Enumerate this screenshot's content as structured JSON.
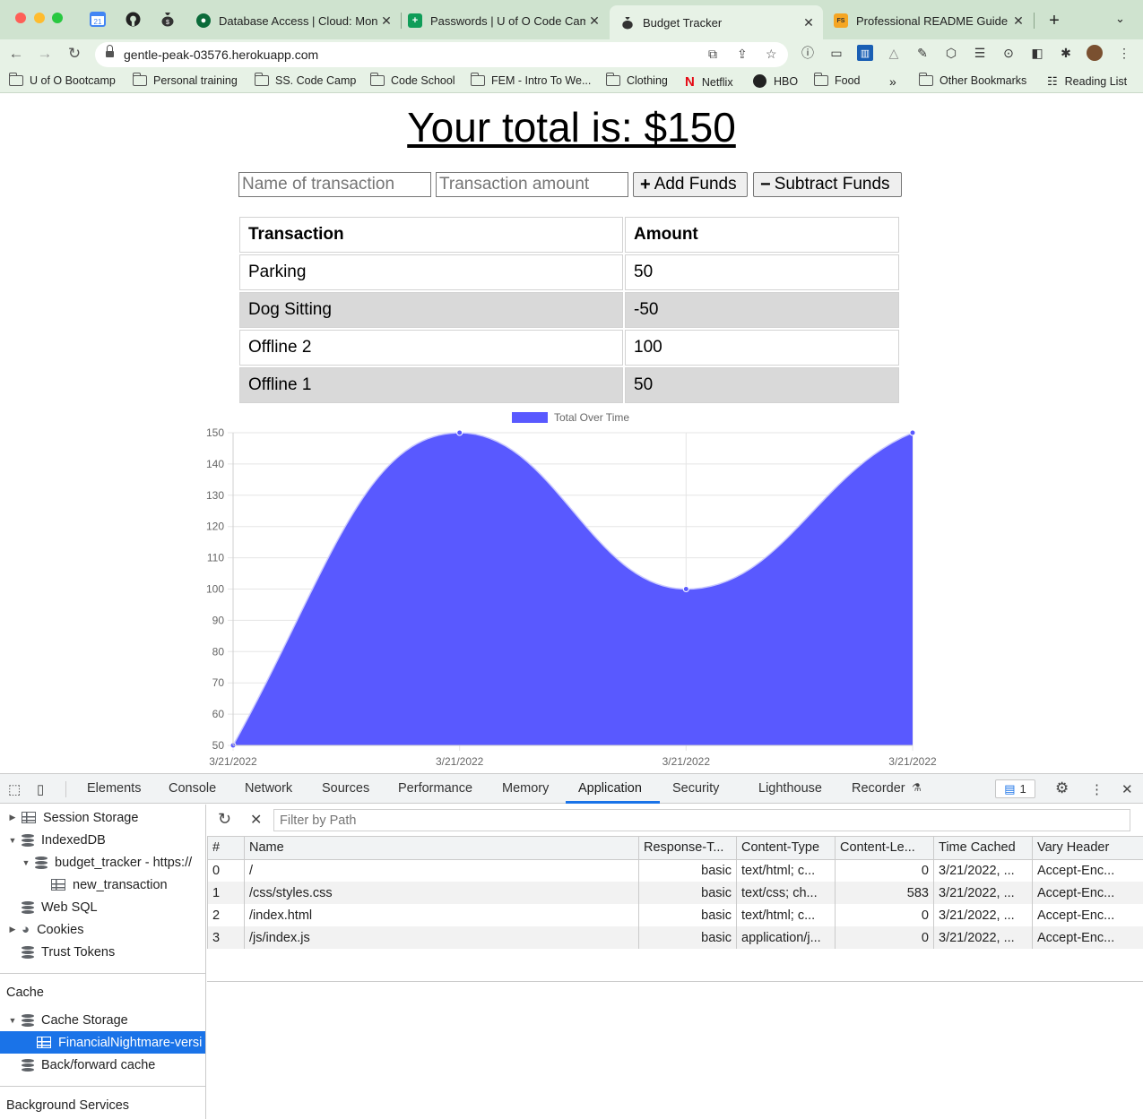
{
  "browser": {
    "tabs": [
      {
        "label": "Database Access | Cloud: Mon",
        "favicon": "mongodb-leaf-icon",
        "color": "#0b6b3a"
      },
      {
        "label": "Passwords | U of O Code Camp",
        "favicon": "sheets-icon",
        "color": "#0f9d58"
      },
      {
        "label": "Budget Tracker",
        "favicon": "money-bag-icon",
        "color": "#333333"
      },
      {
        "label": "Professional README Guide | T",
        "favicon": "fs-icon",
        "color": "#f5a623"
      }
    ],
    "active_tab_index": 2,
    "pinned_tabs": [
      {
        "name": "calendar-icon",
        "text": "21"
      },
      {
        "name": "github-icon",
        "text": ""
      },
      {
        "name": "money-bag-icon",
        "text": ""
      }
    ],
    "url": "gentle-peak-03576.herokuapp.com",
    "bookmarks": [
      "U of O Bootcamp",
      "Personal training",
      "SS. Code Camp",
      "Code School",
      "FEM - Intro To We...",
      "Clothing",
      "Netflix",
      "HBO",
      "Food"
    ],
    "other_bookmarks": "Other Bookmarks",
    "reading_list": "Reading List",
    "overflow": "»"
  },
  "page": {
    "total_text": "Your total is: $150",
    "name_placeholder": "Name of transaction",
    "amount_placeholder": "Transaction amount",
    "add_label": "Add Funds",
    "subtract_label": "Subtract Funds",
    "table_headers": [
      "Transaction",
      "Amount"
    ],
    "transactions": [
      {
        "name": "Parking",
        "amount": "50"
      },
      {
        "name": "Dog Sitting",
        "amount": "-50"
      },
      {
        "name": "Offline 2",
        "amount": "100"
      },
      {
        "name": "Offline 1",
        "amount": "50"
      }
    ]
  },
  "chart_data": {
    "type": "area",
    "x": [
      "3/21/2022",
      "3/21/2022",
      "3/21/2022",
      "3/21/2022"
    ],
    "series": [
      {
        "name": "Total Over Time",
        "values": [
          50,
          150,
          100,
          150
        ],
        "color": "#5959ff"
      }
    ],
    "ylim": [
      50,
      150
    ],
    "yticks": [
      50,
      60,
      70,
      80,
      90,
      100,
      110,
      120,
      130,
      140,
      150
    ],
    "legend": "top",
    "grid": true
  },
  "devtools": {
    "tabs": [
      "Elements",
      "Console",
      "Network",
      "Sources",
      "Performance",
      "Memory",
      "Application",
      "Security",
      "Lighthouse",
      "Recorder"
    ],
    "active_tab": "Application",
    "message_count": "1",
    "sidebar": {
      "session_storage": "Session Storage",
      "indexeddb": "IndexedDB",
      "db_name": "budget_tracker - https://",
      "store_name": "new_transaction",
      "web_sql": "Web SQL",
      "cookies": "Cookies",
      "trust_tokens": "Trust Tokens",
      "cache_heading": "Cache",
      "cache_storage": "Cache Storage",
      "cache_entry": "FinancialNightmare-versi",
      "bfcache": "Back/forward cache",
      "background_heading": "Background Services"
    },
    "filter_placeholder": "Filter by Path",
    "columns": [
      "#",
      "Name",
      "Response-T...",
      "Content-Type",
      "Content-Le...",
      "Time Cached",
      "Vary Header"
    ],
    "rows": [
      [
        "0",
        "/",
        "basic",
        "text/html; c...",
        "0",
        "3/21/2022, ...",
        "Accept-Enc..."
      ],
      [
        "1",
        "/css/styles.css",
        "basic",
        "text/css; ch...",
        "583",
        "3/21/2022, ...",
        "Accept-Enc..."
      ],
      [
        "2",
        "/index.html",
        "basic",
        "text/html; c...",
        "0",
        "3/21/2022, ...",
        "Accept-Enc..."
      ],
      [
        "3",
        "/js/index.js",
        "basic",
        "application/j...",
        "0",
        "3/21/2022, ...",
        "Accept-Enc..."
      ]
    ]
  }
}
